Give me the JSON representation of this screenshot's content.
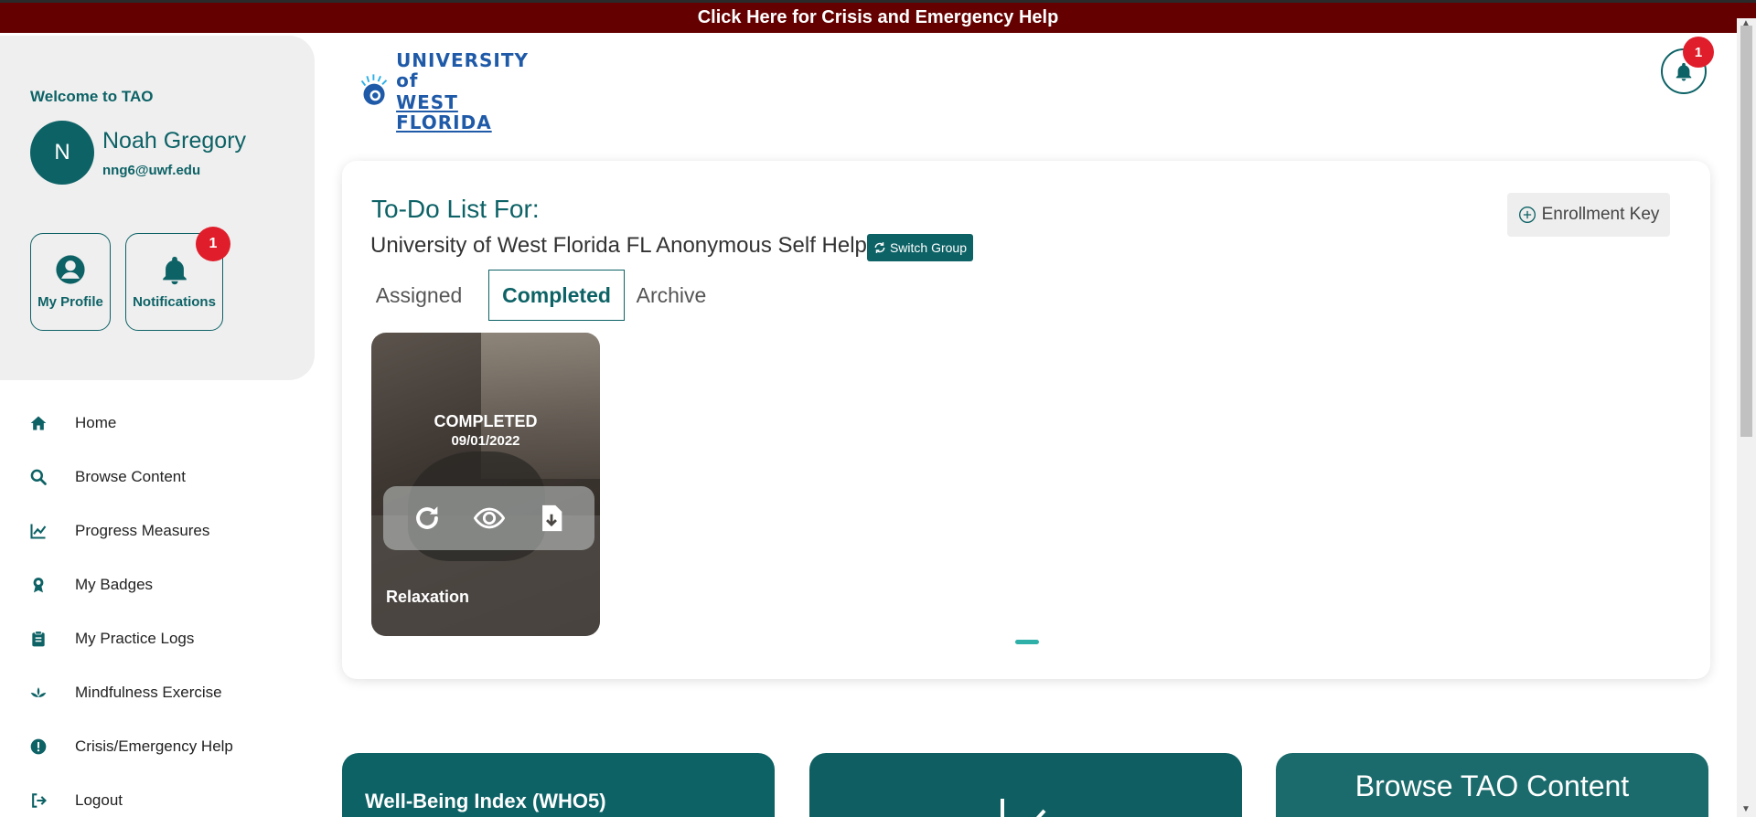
{
  "crisis_banner": "Click Here for Crisis and Emergency Help",
  "sidebar": {
    "welcome": "Welcome to TAO",
    "avatar_initial": "N",
    "user_name": "Noah Gregory",
    "user_email": "nng6@uwf.edu",
    "my_profile_label": "My Profile",
    "notifications_label": "Notifications",
    "notifications_count": "1",
    "nav_items": [
      {
        "label": "Home",
        "icon": "home-icon"
      },
      {
        "label": "Browse Content",
        "icon": "search-icon"
      },
      {
        "label": "Progress Measures",
        "icon": "chart-line-icon"
      },
      {
        "label": "My Badges",
        "icon": "badge-icon"
      },
      {
        "label": "My Practice Logs",
        "icon": "clipboard-icon"
      },
      {
        "label": "Mindfulness Exercise",
        "icon": "lotus-icon"
      },
      {
        "label": "Crisis/Emergency Help",
        "icon": "alert-icon"
      },
      {
        "label": "Logout",
        "icon": "logout-icon"
      }
    ]
  },
  "header": {
    "logo_line1": "UNIVERSITY of",
    "logo_line2": "WEST FLORIDA",
    "bell_count": "1"
  },
  "todo": {
    "title": "To-Do List For:",
    "group_name": "University of West Florida FL Anonymous Self Help",
    "switch_group_label": "Switch Group",
    "enrollment_key_label": "Enrollment Key",
    "tabs": [
      {
        "label": "Assigned",
        "active": false
      },
      {
        "label": "Completed",
        "active": true
      },
      {
        "label": "Archive",
        "active": false
      }
    ],
    "cards": [
      {
        "status": "COMPLETED",
        "date": "09/01/2022",
        "name": "Relaxation"
      }
    ]
  },
  "tiles": {
    "wellbeing": "Well-Being Index (WHO5)",
    "browse": "Browse TAO Content"
  },
  "colors": {
    "primary": "#0d6266",
    "crisis_bar": "#650000",
    "badge": "#e01e2b",
    "pager": "#2eb0a8"
  }
}
